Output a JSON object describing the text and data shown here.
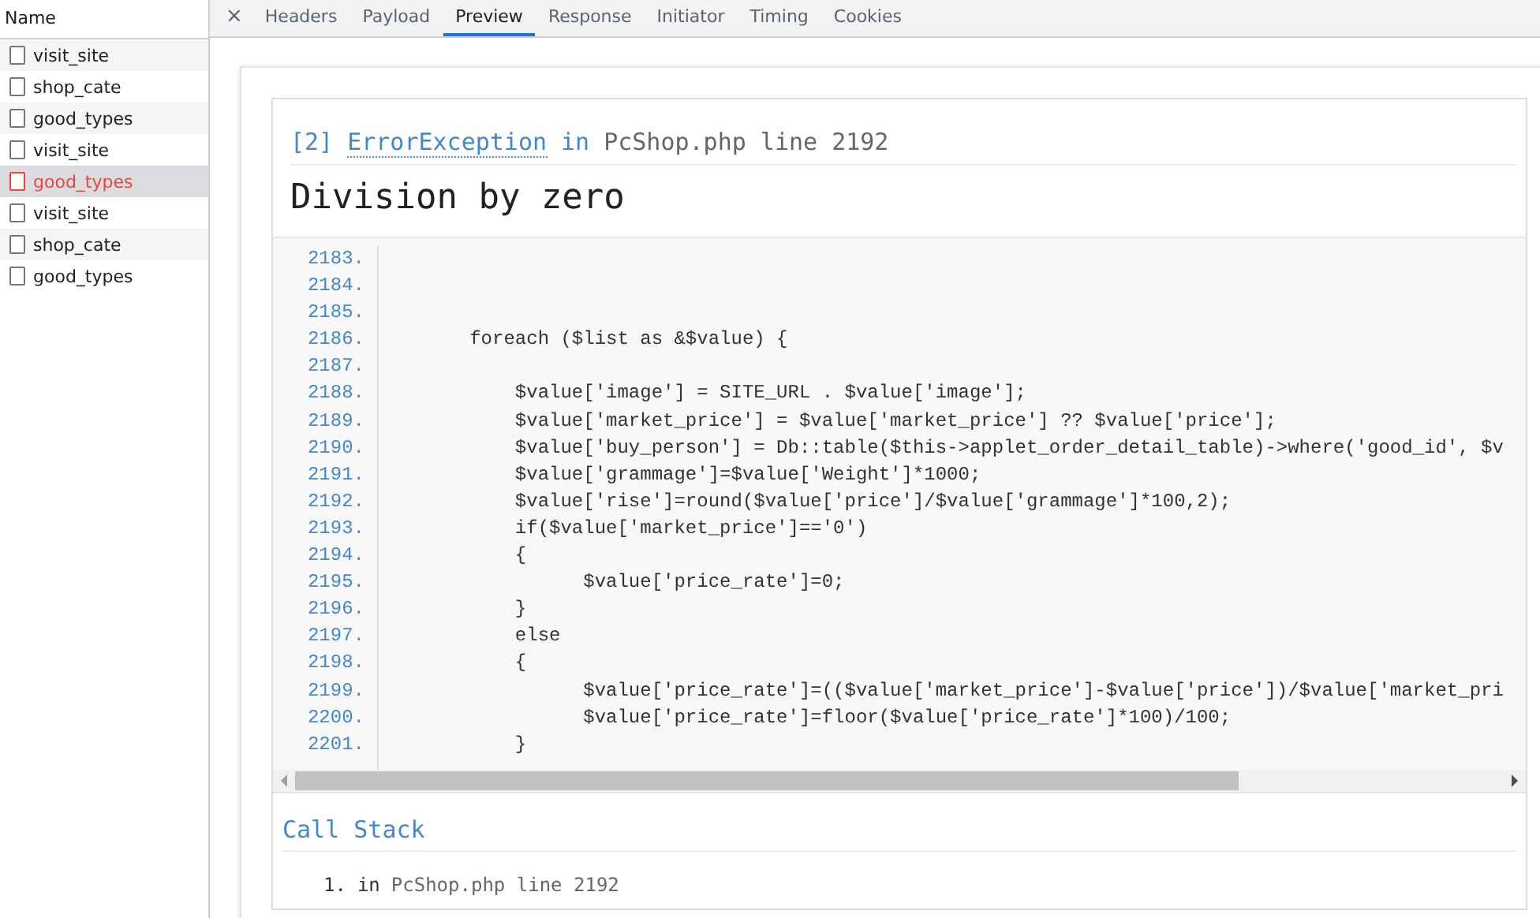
{
  "sidebar": {
    "header": "Name",
    "requests": [
      {
        "name": "visit_site",
        "selected": false,
        "error": false
      },
      {
        "name": "shop_cate",
        "selected": false,
        "error": false
      },
      {
        "name": "good_types",
        "selected": false,
        "error": false
      },
      {
        "name": "visit_site",
        "selected": false,
        "error": false
      },
      {
        "name": "good_types",
        "selected": true,
        "error": true
      },
      {
        "name": "visit_site",
        "selected": false,
        "error": false
      },
      {
        "name": "shop_cate",
        "selected": false,
        "error": false
      },
      {
        "name": "good_types",
        "selected": false,
        "error": false
      }
    ]
  },
  "tabs": {
    "close": "×",
    "items": [
      {
        "label": "Headers",
        "selected": false
      },
      {
        "label": "Payload",
        "selected": false
      },
      {
        "label": "Preview",
        "selected": true
      },
      {
        "label": "Response",
        "selected": false
      },
      {
        "label": "Initiator",
        "selected": false
      },
      {
        "label": "Timing",
        "selected": false
      },
      {
        "label": "Cookies",
        "selected": false
      }
    ]
  },
  "error": {
    "index": "[2]",
    "exception": "ErrorException",
    "in": "in",
    "location": "PcShop.php line 2192",
    "message": "Division by zero"
  },
  "code": {
    "lines": [
      {
        "number": "2183."
      },
      {
        "number": "2184."
      },
      {
        "number": "2185."
      },
      {
        "number": "2186.",
        "text": "        foreach ($list as &$value) {"
      },
      {
        "number": "2187."
      },
      {
        "number": "2188.",
        "text": "            $value['image'] = SITE_URL . $value['image'];"
      },
      {
        "number": "2189.",
        "text": "            $value['market_price'] = $value['market_price'] ?? $value['price'];"
      },
      {
        "number": "2190.",
        "text": "            $value['buy_person'] = Db::table($this->applet_order_detail_table)->where('good_id', $v"
      },
      {
        "number": "2191.",
        "text": "            $value['grammage']=$value['Weight']*1000;"
      },
      {
        "number": "2192.",
        "text": "            $value['rise']=round($value['price']/$value['grammage']*100,2);"
      },
      {
        "number": "2193.",
        "text": "            if($value['market_price']=='0')"
      },
      {
        "number": "2194.",
        "text": "            {"
      },
      {
        "number": "2195.",
        "text": "                  $value['price_rate']=0;"
      },
      {
        "number": "2196.",
        "text": "            }"
      },
      {
        "number": "2197.",
        "text": "            else"
      },
      {
        "number": "2198.",
        "text": "            {"
      },
      {
        "number": "2199.",
        "text": "                  $value['price_rate']=(($value['market_price']-$value['price'])/$value['market_pri"
      },
      {
        "number": "2200.",
        "text": "                  $value['price_rate']=floor($value['price_rate']*100)/100;"
      },
      {
        "number": "2201.",
        "text": "            }"
      }
    ]
  },
  "call_stack": {
    "title": "Call Stack",
    "entries": [
      {
        "number": "1.",
        "in": "in",
        "location": "PcShop.php line 2192"
      }
    ]
  }
}
